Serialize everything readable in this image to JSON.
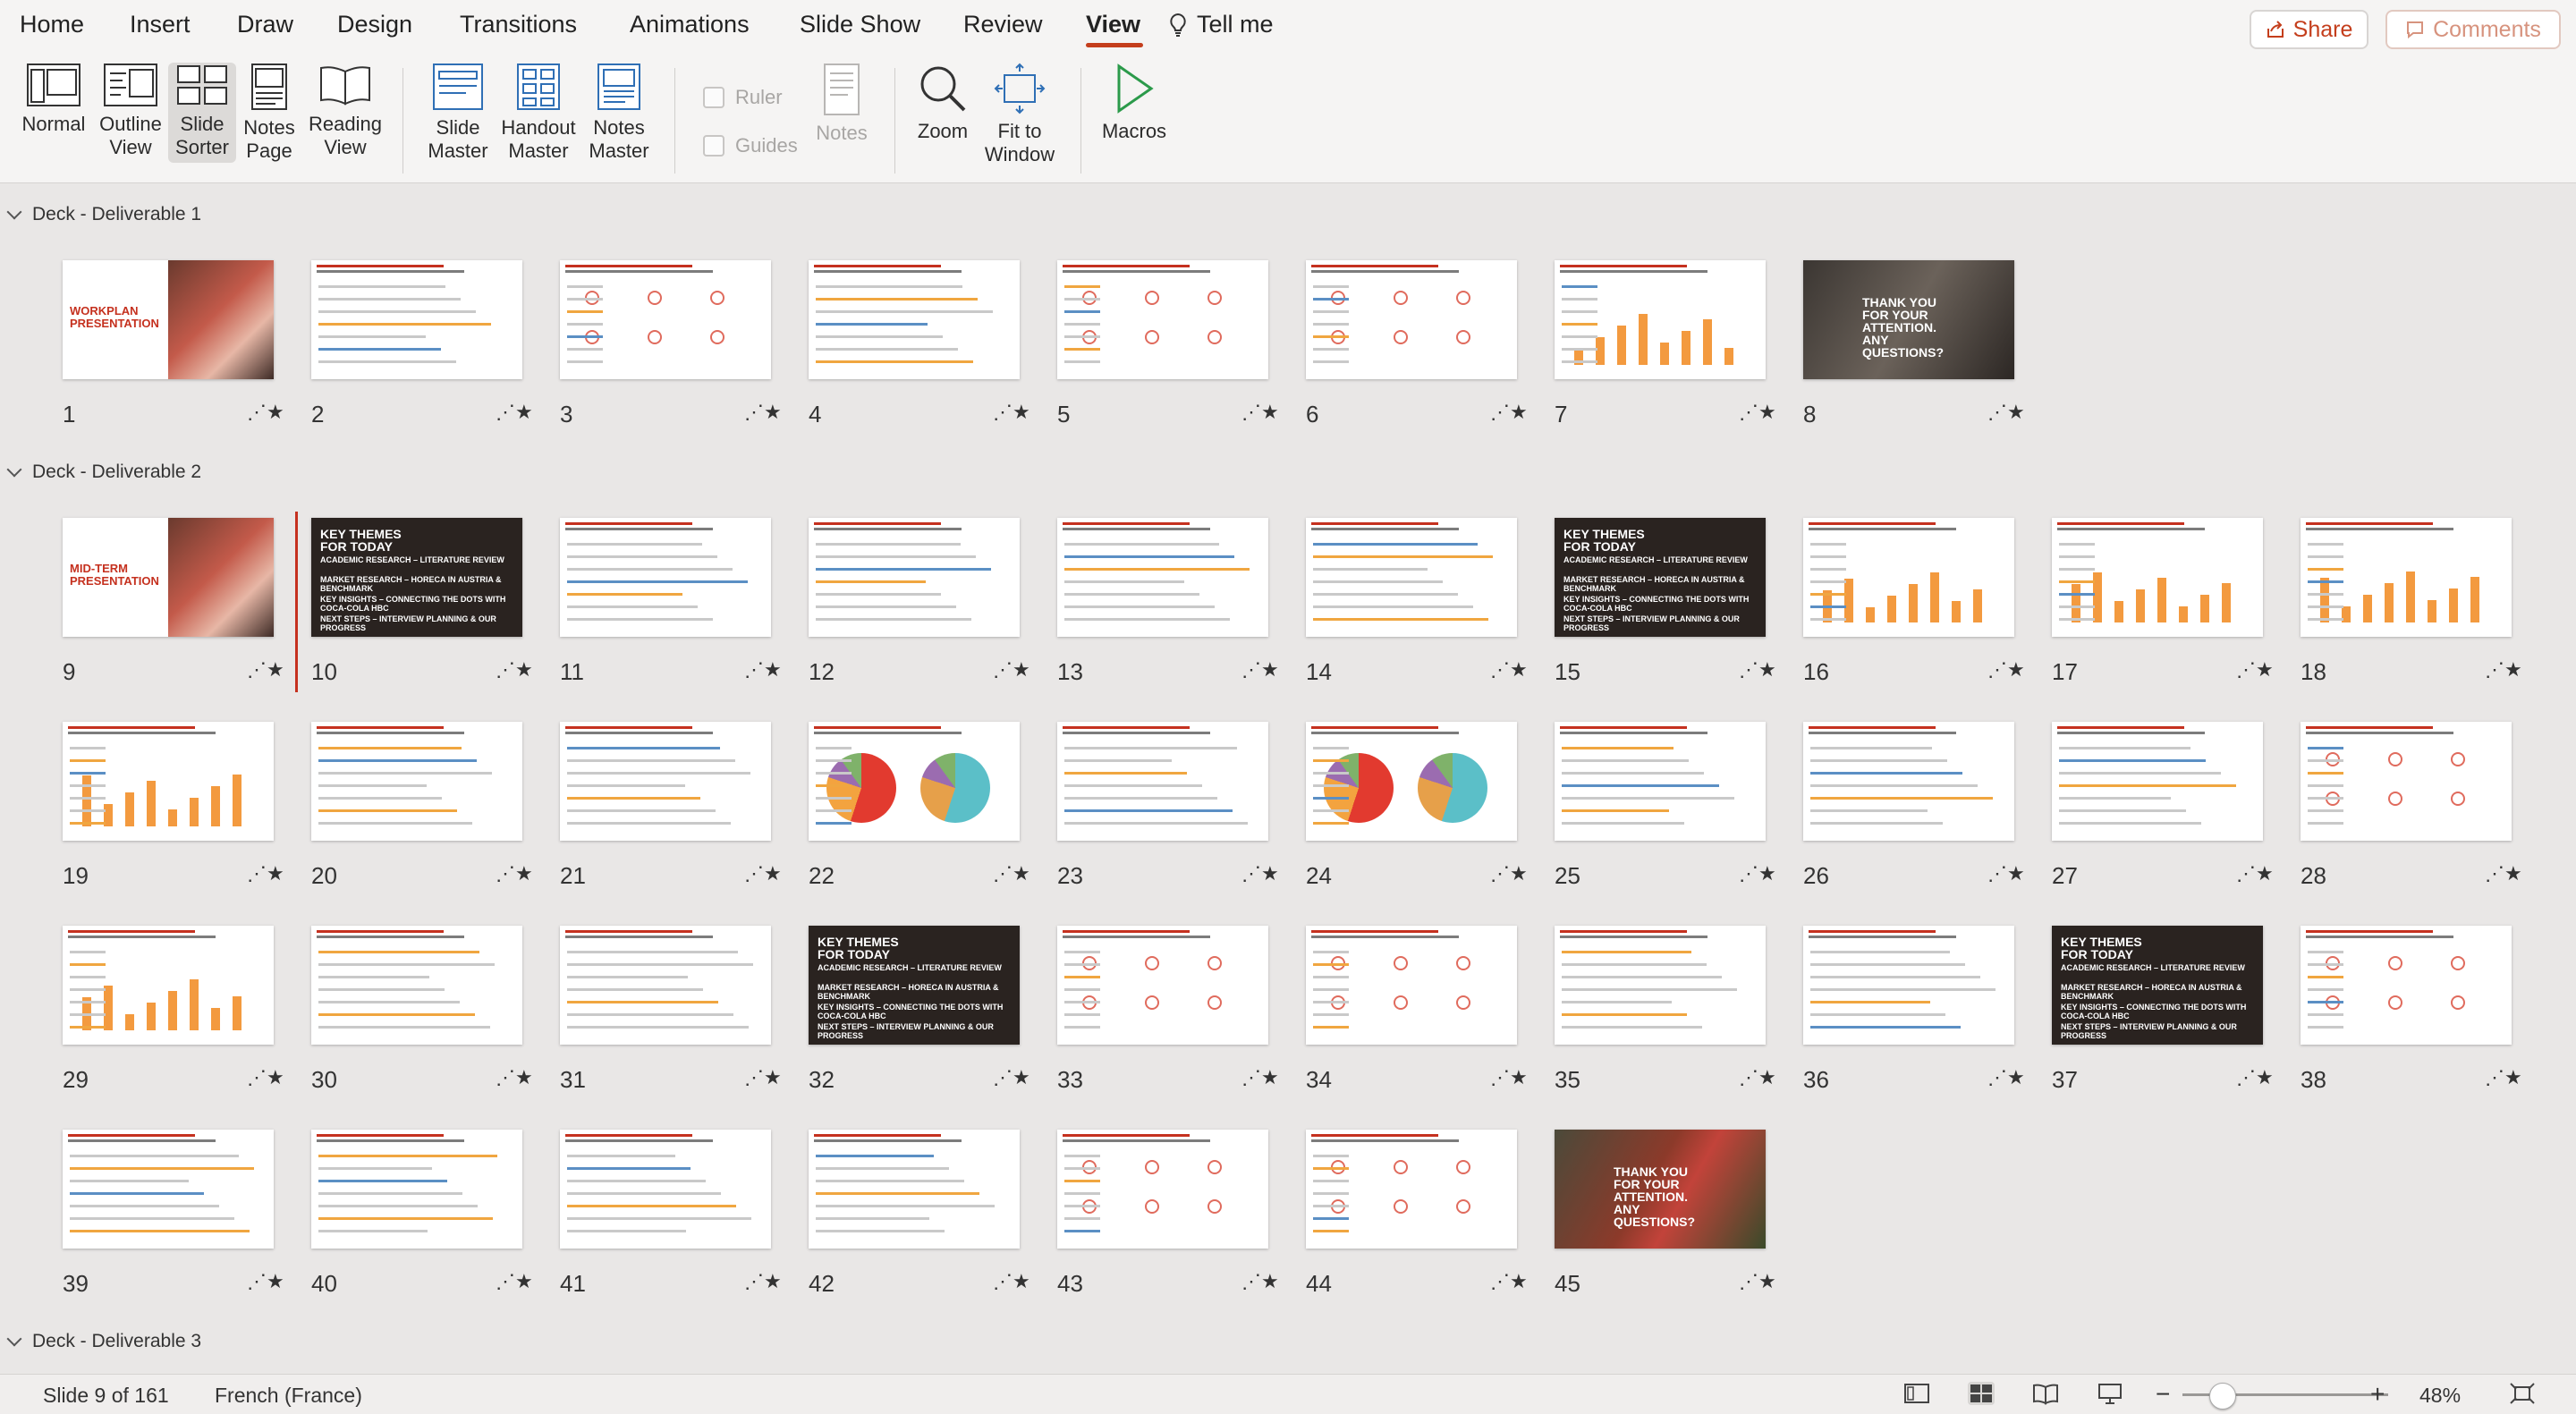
{
  "tabs": [
    "Home",
    "Insert",
    "Draw",
    "Design",
    "Transitions",
    "Animations",
    "Slide Show",
    "Review",
    "View",
    "Tell me"
  ],
  "active_tab": "View",
  "share_label": "Share",
  "comments_label": "Comments",
  "ribbon": {
    "normal": "Normal",
    "outline_view": "Outline View",
    "slide_sorter": "Slide Sorter",
    "notes_page": "Notes Page",
    "reading_view": "Reading View",
    "slide_master": "Slide Master",
    "handout_master": "Handout Master",
    "notes_master": "Notes Master",
    "ruler": "Ruler",
    "guides": "Guides",
    "notes": "Notes",
    "zoom": "Zoom",
    "fit_to_window": "Fit to Window",
    "macros": "Macros"
  },
  "sections": [
    {
      "label": "Deck - Deliverable 1"
    },
    {
      "label": "Deck - Deliverable 2"
    },
    {
      "label": "Deck - Deliverable 3"
    }
  ],
  "thumb_texts": {
    "workplan": "WORKPLAN PRESENTATION",
    "midterm": "MID-TERM PRESENTATION",
    "thanks": "THANK YOU FOR YOUR ATTENTION. ANY QUESTIONS?",
    "key_themes": "KEY THEMES FOR TODAY",
    "kt1": "ACADEMIC RESEARCH – LITERATURE REVIEW",
    "kt2": "MARKET RESEARCH – HORECA IN AUSTRIA & BENCHMARK",
    "kt3": "KEY INSIGHTS – CONNECTING THE DOTS WITH COCA-COLA HBC",
    "kt4": "NEXT STEPS – INTERVIEW PLANNING & OUR PROGRESS"
  },
  "slide_numbers": [
    "1",
    "2",
    "3",
    "4",
    "5",
    "6",
    "7",
    "8",
    "9",
    "10",
    "11",
    "12",
    "13",
    "14",
    "15",
    "16",
    "17",
    "18",
    "19",
    "20",
    "21",
    "22",
    "23",
    "24",
    "25",
    "26",
    "27",
    "28",
    "29",
    "30",
    "31",
    "32",
    "33",
    "34",
    "35",
    "36",
    "37",
    "38",
    "39",
    "40",
    "41",
    "42",
    "43",
    "44",
    "45"
  ],
  "status": {
    "slide_info": "Slide 9 of 161",
    "language": "French (France)",
    "zoom_minus": "−",
    "zoom_plus": "+",
    "zoom_level": "48%"
  }
}
